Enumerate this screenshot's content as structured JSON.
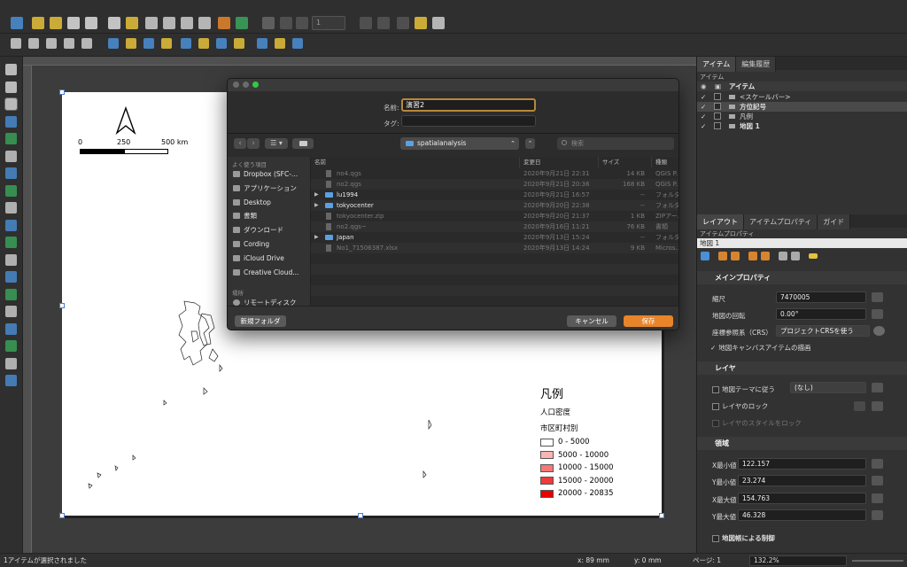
{
  "toolbar_page": {
    "page_number": "1"
  },
  "layout": {
    "scale_labels": [
      "0",
      "250",
      "500 km"
    ]
  },
  "legend": {
    "title": "凡例",
    "subtitle": "人口密度",
    "group": "市区町村別",
    "classes": [
      {
        "label": "0 - 5000",
        "color": "#ffffff"
      },
      {
        "label": "5000 - 10000",
        "color": "#fbb4b4"
      },
      {
        "label": "10000 - 15000",
        "color": "#f47878"
      },
      {
        "label": "15000 - 20000",
        "color": "#ee3b3b"
      },
      {
        "label": "20000 - 20835",
        "color": "#e60000"
      }
    ]
  },
  "dialog": {
    "name_label": "名前:",
    "name_value": "演習2",
    "tags_label": "タグ:",
    "location": "spatialanalysis",
    "search_placeholder": "検索",
    "favorites_header": "よく使う項目",
    "favorites": [
      "Dropbox (SFC-...",
      "アプリケーション",
      "Desktop",
      "書類",
      "ダウンロード",
      "Cording",
      "iCloud Drive",
      "Creative Cloud..."
    ],
    "places_header": "場所",
    "places": [
      "リモートディスク"
    ],
    "columns": {
      "name": "名前",
      "date": "変更日",
      "size": "サイズ",
      "kind": "種類"
    },
    "files": [
      {
        "name": "no4.qgs",
        "date": "2020年9月21日 22:31",
        "size": "14 KB",
        "kind": "QGIS P...",
        "folder": false,
        "enabled": false
      },
      {
        "name": "no2.qgs",
        "date": "2020年9月21日 20:36",
        "size": "168 KB",
        "kind": "QGIS P...",
        "folder": false,
        "enabled": false
      },
      {
        "name": "lu1994",
        "date": "2020年9月21日 16:57",
        "size": "--",
        "kind": "フォルダ",
        "folder": true,
        "enabled": true
      },
      {
        "name": "tokyocenter",
        "date": "2020年9月20日 22:38",
        "size": "--",
        "kind": "フォルダ",
        "folder": true,
        "enabled": true
      },
      {
        "name": "tokyocenter.zip",
        "date": "2020年9月20日 21:37",
        "size": "1 KB",
        "kind": "ZIPアー...",
        "folder": false,
        "enabled": false
      },
      {
        "name": "no2.qgs~",
        "date": "2020年9月16日 11:21",
        "size": "76 KB",
        "kind": "書類",
        "folder": false,
        "enabled": false
      },
      {
        "name": "Japan",
        "date": "2020年9月13日 15:24",
        "size": "--",
        "kind": "フォルダ",
        "folder": true,
        "enabled": true
      },
      {
        "name": "No1_71506387.xlsx",
        "date": "2020年9月13日 14:24",
        "size": "9 KB",
        "kind": "Micros...",
        "folder": false,
        "enabled": false
      }
    ],
    "new_folder": "新規フォルダ",
    "cancel": "キャンセル",
    "save": "保存"
  },
  "right_panel": {
    "tabs_top": [
      "アイテム",
      "編集履歴"
    ],
    "items_header": "アイテム",
    "items_col": "アイテム",
    "items": [
      {
        "label": "<スケールバー>",
        "checked": true
      },
      {
        "label": "方位記号",
        "checked": true
      },
      {
        "label": "凡例",
        "checked": true
      },
      {
        "label": "地図 1",
        "checked": true
      }
    ],
    "tabs_bottom": [
      "レイアウト",
      "アイテムプロパティ",
      "ガイド"
    ],
    "props_header": "アイテムプロパティ",
    "selected_item": "地図 1",
    "main_props": "メインプロパティ",
    "scale_label": "縮尺",
    "scale_value": "7470005",
    "rotation_label": "地図の回転",
    "rotation_value": "0.00°",
    "crs_label": "座標参照系（CRS）",
    "crs_value": "プロジェクトCRSを使う",
    "draw_canvas_label": "地図キャンバスアイテムの描画",
    "layers_section": "レイヤ",
    "follow_theme": "地図テーマに従う",
    "theme_value": "(なし)",
    "lock_layers": "レイヤのロック",
    "lock_styles": "レイヤのスタイルをロック",
    "extent_section": "領域",
    "xmin_label": "X最小値",
    "xmin": "122.157",
    "ymin_label": "Y最小値",
    "ymin": "23.274",
    "xmax_label": "X最大値",
    "xmax": "154.763",
    "ymax_label": "Y最大値",
    "ymax": "46.328",
    "atlas_label": "地図帳による制御"
  },
  "status": {
    "message": "1アイテムが選択されました",
    "x": "x: 89 mm",
    "y": "y: 0 mm",
    "page": "ページ: 1",
    "zoom": "132.2%"
  }
}
